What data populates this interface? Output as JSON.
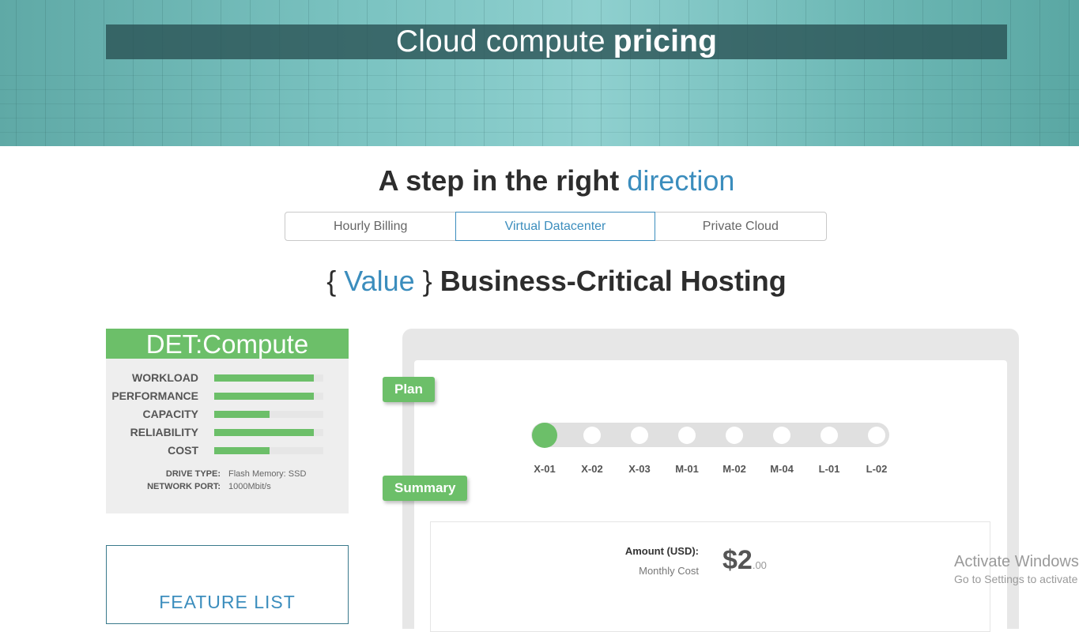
{
  "hero": {
    "title_normal": "Cloud compute",
    "title_bold": "pricing"
  },
  "section": {
    "heading_bold": "A step in the right",
    "heading_accent": "direction"
  },
  "tabs": [
    {
      "label": "Hourly Billing",
      "active": false
    },
    {
      "label": "Virtual Datacenter",
      "active": true
    },
    {
      "label": "Private Cloud",
      "active": false
    }
  ],
  "hosting": {
    "brace_open": "{",
    "value_word": "Value",
    "brace_close": "}",
    "title": "Business-Critical Hosting"
  },
  "card": {
    "title": "DET:Compute",
    "metrics": [
      {
        "label": "WORKLOAD",
        "level": 0.91
      },
      {
        "label": "PERFORMANCE",
        "level": 0.91
      },
      {
        "label": "CAPACITY",
        "level": 0.51
      },
      {
        "label": "RELIABILITY",
        "level": 0.91
      },
      {
        "label": "COST",
        "level": 0.51
      }
    ],
    "specs": [
      {
        "key": "DRIVE TYPE:",
        "value": "Flash Memory: SSD"
      },
      {
        "key": "NETWORK PORT:",
        "value": "1000Mbit/s"
      }
    ]
  },
  "features": {
    "title": "FEATURE LIST"
  },
  "plan": {
    "label": "Plan",
    "stops": [
      "X-01",
      "X-02",
      "X-03",
      "M-01",
      "M-02",
      "M-04",
      "L-01",
      "L-02"
    ],
    "selected": "X-01"
  },
  "summary": {
    "label": "Summary",
    "amount_label": "Amount (USD):",
    "amount_sub": "Monthly Cost",
    "price_main": "$2",
    "price_cents": ".00"
  },
  "watermark": {
    "line1": "Activate Windows",
    "line2": "Go to Settings to activate Windows."
  },
  "colors": {
    "accent_blue": "#3b8dbd",
    "green": "#6cbf69",
    "hero_teal": "#7cc4c2"
  }
}
